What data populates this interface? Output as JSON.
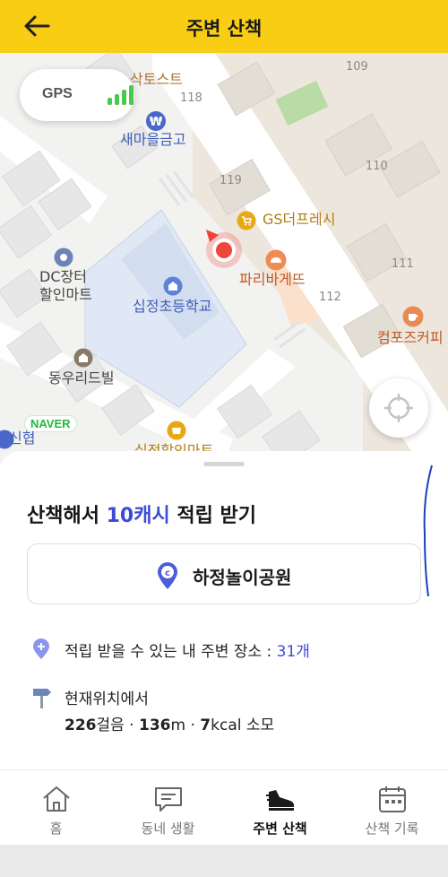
{
  "header": {
    "title": "주변 산책"
  },
  "map": {
    "gps_label": "GPS",
    "naver_logo": "NAVER",
    "block_numbers": [
      "109",
      "118",
      "119",
      "110",
      "111",
      "112"
    ],
    "places": {
      "toast": "삭토스트",
      "bank": "새마을금고",
      "gs": "GS더프레시",
      "paris": "파리바게뜨",
      "school": "십정초등학교",
      "dc_line1": "DC장터",
      "dc_line2": "할인마트",
      "compose": "컴포즈커피",
      "dongwoo": "동우리드빌",
      "shinhyup": "신협",
      "discount": "십정할인마트"
    },
    "colors": {
      "accent_yellow": "#f9cd14",
      "marker_red": "#f0453a",
      "brand_blue": "#3d4bd6",
      "naver_green": "#20b93b"
    }
  },
  "sheet": {
    "headline_prefix": "산책해서 ",
    "headline_highlight": "10캐시",
    "headline_suffix": " 적립 받기",
    "place_name": "하정놀이공원",
    "nearby_label": "적립 받을 수 있는 내 주변 장소 : ",
    "nearby_count": "31개",
    "from_here": "현재위치에서",
    "steps_value": "226",
    "steps_unit": "걸음 · ",
    "distance_value": "136",
    "distance_unit": "m · ",
    "kcal_value": "7",
    "kcal_unit": "kcal 소모"
  },
  "nav": {
    "tabs": [
      {
        "label": "홈",
        "icon": "home-icon",
        "active": false
      },
      {
        "label": "동네 생활",
        "icon": "chat-icon",
        "active": false
      },
      {
        "label": "주변 산책",
        "icon": "sneaker-icon",
        "active": true
      },
      {
        "label": "산책 기록",
        "icon": "calendar-icon",
        "active": false
      }
    ]
  }
}
